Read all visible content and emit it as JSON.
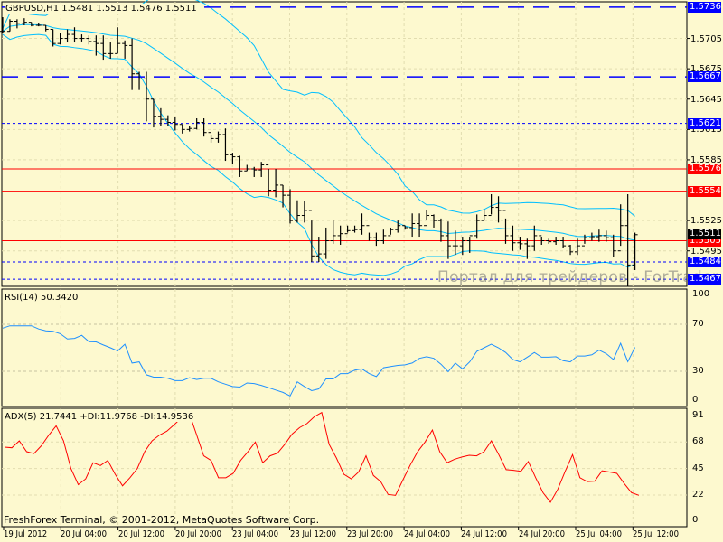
{
  "chart": {
    "title": "GBPUSD,H1  1.5481 1.5513 1.5476 1.5511",
    "watermark": "Портал для трейдеров - ForTrader.ru",
    "copyright": "FreshForex Terminal, © 2001-2012, MetaQuotes Software Corp.",
    "colors": {
      "background": "#FDF9CF",
      "bands": "#00BFFF",
      "rsi": "#1E90FF",
      "adx": "#FF0000",
      "level_blue": "#0000FF",
      "level_red": "#FF0000"
    }
  },
  "price_axis": {
    "ticks": [
      "1.5705",
      "1.5675",
      "1.5645",
      "1.5615",
      "1.5585",
      "1.5525",
      "1.5495"
    ],
    "levels": [
      {
        "price": "1.5736",
        "color": "#0000FF",
        "style": "longdash"
      },
      {
        "price": "1.5667",
        "color": "#0000FF",
        "style": "longdash"
      },
      {
        "price": "1.5621",
        "color": "#0000FF",
        "style": "dot"
      },
      {
        "price": "1.5576",
        "color": "#FF0000",
        "style": "solid"
      },
      {
        "price": "1.5554",
        "color": "#FF0000",
        "style": "solid"
      },
      {
        "price": "1.5505",
        "color": "#FF0000",
        "style": "solid"
      },
      {
        "price": "1.5484",
        "color": "#0000FF",
        "style": "dot"
      },
      {
        "price": "1.5467",
        "color": "#0000FF",
        "style": "dot"
      }
    ],
    "current_price": "1.5511"
  },
  "time_axis": [
    "19 Jul 2012",
    "20 Jul 04:00",
    "20 Jul 12:00",
    "20 Jul 20:00",
    "23 Jul 04:00",
    "23 Jul 12:00",
    "23 Jul 20:00",
    "24 Jul 04:00",
    "24 Jul 12:00",
    "24 Jul 20:00",
    "25 Jul 04:00",
    "25 Jul 12:00"
  ],
  "rsi": {
    "label": "RSI(14) 50.3420",
    "ticks": [
      "100",
      "70",
      "30",
      "0"
    ],
    "values": [
      66.7,
      68.7,
      68.7,
      68.7,
      68.7,
      66,
      64.4,
      64,
      62,
      57.5,
      58,
      60.6,
      55.2,
      55,
      52.4,
      50,
      47.3,
      53,
      37,
      38,
      27,
      25,
      25,
      24,
      22,
      22,
      24.5,
      23,
      24,
      24,
      21,
      19,
      17,
      16.5,
      20,
      19.5,
      18,
      16,
      14,
      12,
      9,
      21,
      17,
      13.5,
      15,
      23.5,
      23.5,
      28,
      28,
      31,
      32,
      28,
      25.5,
      33,
      34,
      35,
      35.5,
      37,
      41,
      42.4,
      41,
      36,
      29.6,
      37,
      32,
      38,
      47,
      50,
      53,
      50,
      46,
      40,
      38,
      42,
      46,
      42,
      42,
      42.4,
      39,
      38,
      43,
      43,
      44,
      48,
      45,
      40,
      53.8,
      38.2,
      50.34
    ]
  },
  "adx": {
    "label": "ADX(5) 21.7441 +DI:11.9768 -DI:14.9536",
    "ticks": [
      "91",
      "68",
      "45",
      "22",
      "0"
    ],
    "values": [
      63.5,
      63,
      69,
      59.6,
      58,
      64.8,
      74,
      82,
      69,
      45,
      31,
      36,
      50,
      47.6,
      52,
      40,
      30,
      37,
      45,
      59.6,
      69,
      74,
      77.4,
      83,
      89,
      93.6,
      75,
      56,
      52,
      37,
      37,
      40.8,
      52,
      59.6,
      68,
      50,
      56,
      58.3,
      66,
      75,
      80.5,
      84,
      90,
      93.6,
      66,
      54,
      40,
      36,
      42,
      56,
      39,
      33.6,
      22.5,
      21.7,
      35,
      48,
      59.6,
      68,
      78.4,
      59.6,
      50,
      53,
      55,
      56.5,
      56,
      59.6,
      69,
      57,
      44,
      43.4,
      42.6,
      51,
      37,
      24,
      15.7,
      27,
      42.6,
      57,
      37,
      33.6,
      34,
      43,
      42,
      40.8,
      32,
      24,
      21.7
    ]
  },
  "bars_hlc": [
    [
      1.5726,
      1.571,
      1.5712
    ],
    [
      1.5724,
      1.5712,
      1.5722
    ],
    [
      1.5724,
      1.5715,
      1.572
    ],
    [
      1.5725,
      1.5718,
      1.5721
    ],
    [
      1.5721,
      1.5717,
      1.5718
    ],
    [
      1.572,
      1.5717,
      1.5718
    ],
    [
      1.5718,
      1.5712,
      1.5714
    ],
    [
      1.5714,
      1.5697,
      1.57
    ],
    [
      1.571,
      1.5699,
      1.5705
    ],
    [
      1.5714,
      1.5701,
      1.5709
    ],
    [
      1.5716,
      1.5701,
      1.5705
    ],
    [
      1.5709,
      1.5702,
      1.5705
    ],
    [
      1.5708,
      1.5699,
      1.5702
    ],
    [
      1.5708,
      1.5688,
      1.57
    ],
    [
      1.5708,
      1.5684,
      1.569
    ],
    [
      1.5701,
      1.5685,
      1.569
    ],
    [
      1.5716,
      1.569,
      1.57
    ],
    [
      1.5703,
      1.5685,
      1.5698
    ],
    [
      1.5705,
      1.5654,
      1.567
    ],
    [
      1.5672,
      1.5654,
      1.5665
    ],
    [
      1.5672,
      1.5623,
      1.5645
    ],
    [
      1.5645,
      1.5617,
      1.5628
    ],
    [
      1.5636,
      1.5618,
      1.5625
    ],
    [
      1.5629,
      1.5618,
      1.5622
    ],
    [
      1.5627,
      1.5614,
      1.562
    ],
    [
      1.562,
      1.5611,
      1.5615
    ],
    [
      1.5618,
      1.5613,
      1.5616
    ],
    [
      1.5626,
      1.5615,
      1.5622
    ],
    [
      1.5626,
      1.5608,
      1.5612
    ],
    [
      1.561,
      1.5602,
      1.5606
    ],
    [
      1.5613,
      1.5602,
      1.561
    ],
    [
      1.5616,
      1.5584,
      1.559
    ],
    [
      1.5592,
      1.5581,
      1.5588
    ],
    [
      1.5589,
      1.5568,
      1.5574
    ],
    [
      1.558,
      1.5574,
      1.5576
    ],
    [
      1.5578,
      1.5568,
      1.5575
    ],
    [
      1.5583,
      1.5568,
      1.558
    ],
    [
      1.5576,
      1.5549,
      1.5555
    ],
    [
      1.5576,
      1.5548,
      1.556
    ],
    [
      1.556,
      1.5538,
      1.555
    ],
    [
      1.5556,
      1.5522,
      1.5525
    ],
    [
      1.5545,
      1.5523,
      1.553
    ],
    [
      1.5544,
      1.5523,
      1.5535
    ],
    [
      1.5525,
      1.5484,
      1.549
    ],
    [
      1.5509,
      1.5484,
      1.5492
    ],
    [
      1.5518,
      1.5487,
      1.5505
    ],
    [
      1.5525,
      1.5502,
      1.551
    ],
    [
      1.552,
      1.5501,
      1.5512
    ],
    [
      1.552,
      1.5513,
      1.5515
    ],
    [
      1.552,
      1.5513,
      1.5516
    ],
    [
      1.5532,
      1.5511,
      1.552
    ],
    [
      1.5513,
      1.5505,
      1.5508
    ],
    [
      1.5513,
      1.55,
      1.5505
    ],
    [
      1.5516,
      1.5502,
      1.551
    ],
    [
      1.5518,
      1.5511,
      1.5516
    ],
    [
      1.5525,
      1.5513,
      1.552
    ],
    [
      1.552,
      1.5516,
      1.5518
    ],
    [
      1.5532,
      1.5509,
      1.5522
    ],
    [
      1.5532,
      1.5509,
      1.552
    ],
    [
      1.5535,
      1.5526,
      1.553
    ],
    [
      1.5531,
      1.5518,
      1.5525
    ],
    [
      1.5527,
      1.5504,
      1.551
    ],
    [
      1.5524,
      1.5487,
      1.55
    ],
    [
      1.5515,
      1.5491,
      1.55
    ],
    [
      1.5509,
      1.5491,
      1.5505
    ],
    [
      1.5509,
      1.5493,
      1.551
    ],
    [
      1.5531,
      1.5507,
      1.5525
    ],
    [
      1.5536,
      1.5526,
      1.553
    ],
    [
      1.5551,
      1.5531,
      1.5538
    ],
    [
      1.5549,
      1.5523,
      1.5535
    ],
    [
      1.5527,
      1.5502,
      1.551
    ],
    [
      1.552,
      1.5495,
      1.5503
    ],
    [
      1.5509,
      1.5496,
      1.5502
    ],
    [
      1.5507,
      1.5487,
      1.55
    ],
    [
      1.552,
      1.5495,
      1.551
    ],
    [
      1.5509,
      1.5501,
      1.5505
    ],
    [
      1.5507,
      1.5502,
      1.5504
    ],
    [
      1.5509,
      1.5501,
      1.5505
    ],
    [
      1.5509,
      1.5498,
      1.55
    ],
    [
      1.5501,
      1.5491,
      1.5494
    ],
    [
      1.5507,
      1.5491,
      1.55
    ],
    [
      1.5511,
      1.5502,
      1.5508
    ],
    [
      1.5513,
      1.5505,
      1.5509
    ],
    [
      1.5516,
      1.5504,
      1.551
    ],
    [
      1.5515,
      1.5504,
      1.5508
    ],
    [
      1.5511,
      1.5489,
      1.5495
    ],
    [
      1.5541,
      1.55,
      1.552
    ],
    [
      1.5551,
      1.546,
      1.5481
    ],
    [
      1.5513,
      1.5476,
      1.5511
    ]
  ]
}
